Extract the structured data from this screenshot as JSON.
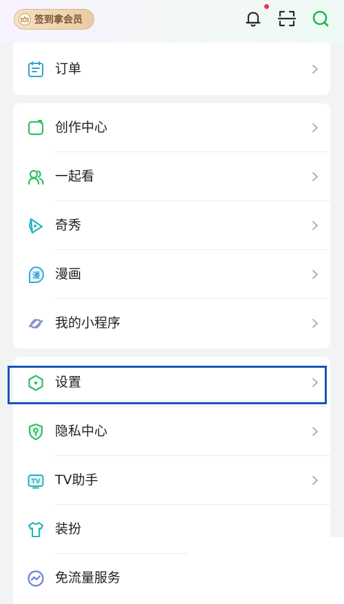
{
  "header": {
    "checkin_label": "签到拿会员",
    "icons": [
      "crown-icon",
      "bell-icon",
      "scan-icon",
      "search-icon"
    ],
    "notification_dot_color": "#f0334a"
  },
  "menu_group_1": [
    {
      "label": "订单",
      "icon": "order-icon"
    }
  ],
  "menu_group_2": [
    {
      "label": "创作中心",
      "icon": "creator-icon"
    },
    {
      "label": "一起看",
      "icon": "watch-together-icon"
    },
    {
      "label": "奇秀",
      "icon": "qixiu-icon"
    },
    {
      "label": "漫画",
      "icon": "comic-icon"
    },
    {
      "label": "我的小程序",
      "icon": "mini-program-icon"
    }
  ],
  "menu_group_3": [
    {
      "label": "设置",
      "icon": "settings-icon"
    },
    {
      "label": "隐私中心",
      "icon": "privacy-icon"
    },
    {
      "label": "TV助手",
      "icon": "tv-icon"
    },
    {
      "label": "装扮",
      "icon": "dress-up-icon"
    },
    {
      "label": "免流量服务",
      "icon": "free-data-icon"
    }
  ],
  "colors": {
    "accent": "#2fbf62",
    "highlight_border": "#1553b8"
  }
}
